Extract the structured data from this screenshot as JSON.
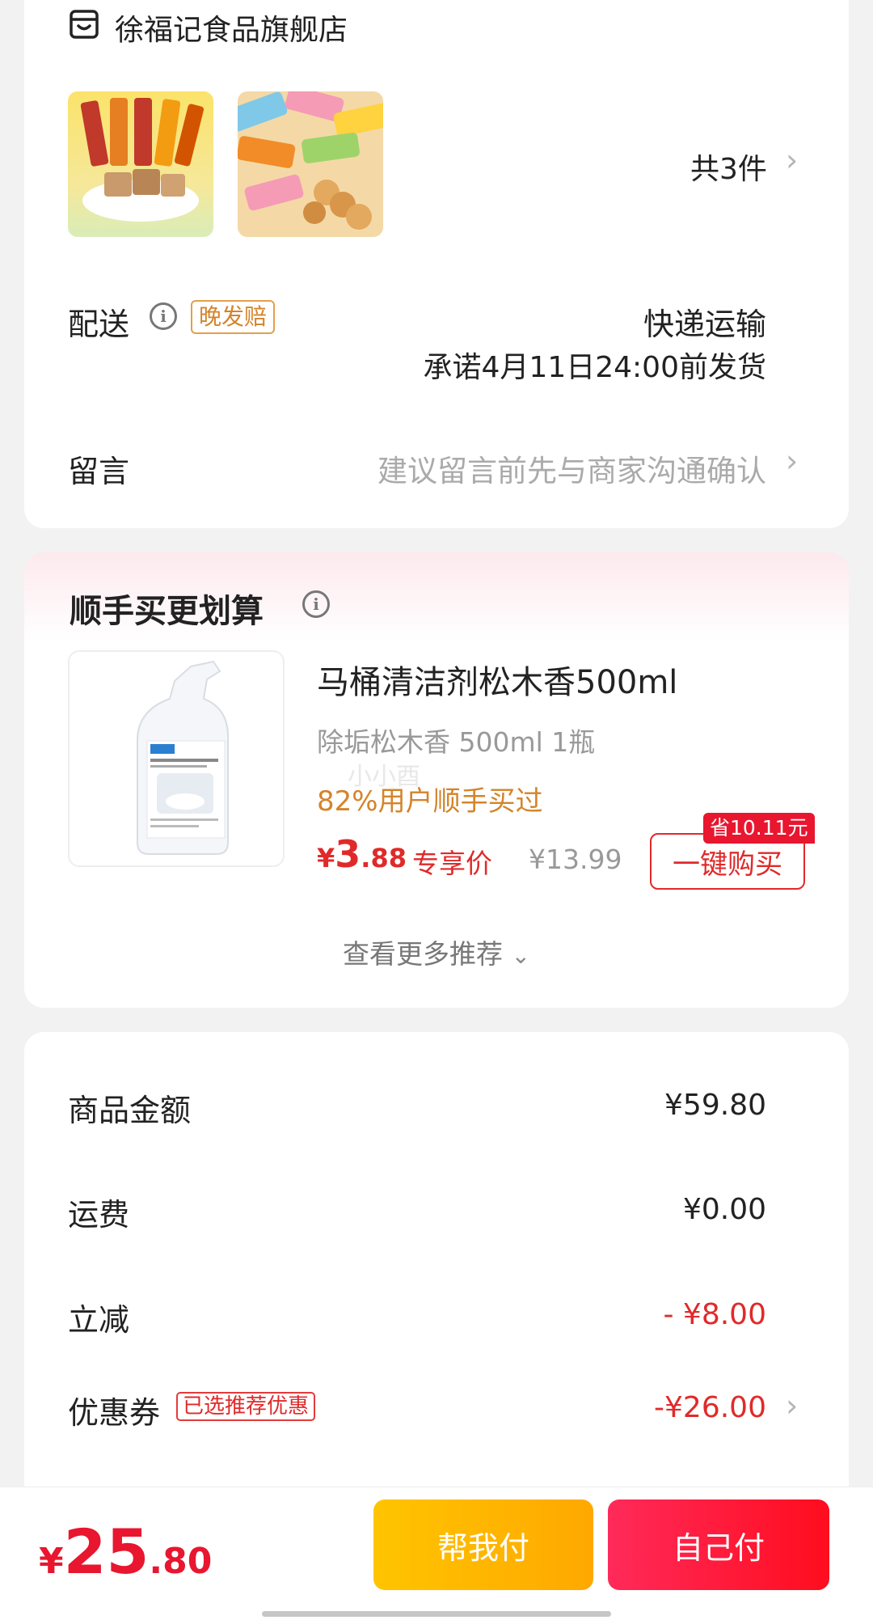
{
  "store": {
    "name": "徐福记食品旗舰店",
    "icon": "shop-icon",
    "item_count": "共3件"
  },
  "delivery": {
    "label": "配送",
    "badge": "晚发赔",
    "method": "快递运输",
    "promise": "承诺4月11日24:00前发货"
  },
  "message": {
    "label": "留言",
    "placeholder": "建议留言前先与商家沟通确认"
  },
  "addon": {
    "title": "顺手买更划算",
    "product_name": "马桶清洁剂松木香500ml",
    "spec": "除垢松木香 500ml 1瓶",
    "social_proof": "82%用户顺手买过",
    "price_symbol": "¥",
    "price_int": "3",
    "price_dec": ".88",
    "price_tag": "专享价",
    "original_price": "¥13.99",
    "save_badge": "省10.11元",
    "buy_button": "一键购买",
    "more_link": "查看更多推荐",
    "watermark": "小小酉"
  },
  "summary": {
    "rows": [
      {
        "label": "商品金额",
        "value": "¥59.80"
      },
      {
        "label": "运费",
        "value": "¥0.00"
      },
      {
        "label": "立减",
        "value": "- ¥8.00"
      },
      {
        "label": "优惠券",
        "badge": "已选推荐优惠",
        "value": "-¥26.00"
      }
    ]
  },
  "footer": {
    "total_symbol": "¥",
    "total_int": "25",
    "total_dec": ".80",
    "help_pay": "帮我付",
    "self_pay": "自己付"
  },
  "colors": {
    "accent_red": "#e02a2a",
    "accent_orange": "#d4842a",
    "help_btn": "#ffb400",
    "self_btn": "#ff1f4a"
  }
}
